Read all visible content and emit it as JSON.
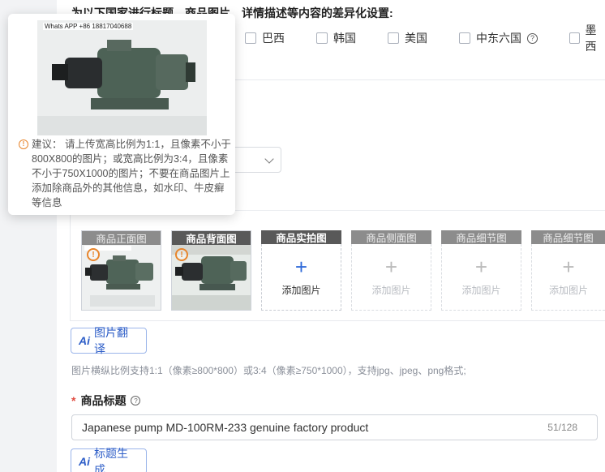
{
  "countries": {
    "heading": "为以下国家进行标题、商品图片、详情描述等内容的差异化设置:",
    "items": [
      {
        "label": "巴西"
      },
      {
        "label": "韩国"
      },
      {
        "label": "美国"
      },
      {
        "label": "中东六国",
        "help": "?"
      },
      {
        "label": "墨西"
      }
    ]
  },
  "images": {
    "slots": [
      {
        "title": "商品正面图",
        "style": "grey",
        "filled": true,
        "watermark": "Whats APP +86 18817040688"
      },
      {
        "title": "商品背面图",
        "style": "dark",
        "filled": true,
        "watermark": "Magnet Pump"
      },
      {
        "title": "商品实拍图",
        "style": "dark",
        "add_label": "添加图片"
      },
      {
        "title": "商品侧面图",
        "style": "grey",
        "add_label": "添加图片"
      },
      {
        "title": "商品细节图",
        "style": "grey",
        "add_label": "添加图片"
      },
      {
        "title": "商品细节图",
        "style": "grey",
        "add_label": "添加图片"
      }
    ],
    "translate_button": {
      "ai": "Ai",
      "label": "图片翻译"
    },
    "hint": "图片横纵比例支持1:1（像素≥800*800）或3:4（像素≥750*1000），支持jpg、jpeg、png格式;"
  },
  "title_field": {
    "required": "*",
    "label": "商品标题",
    "help": "?",
    "value": "Japanese  pump MD-100RM-233 genuine factory product",
    "counter": "51/128",
    "generate_button": {
      "ai": "Ai",
      "label": "标题生成"
    }
  },
  "tooltip": {
    "watermark": "Whats APP +86 18817040688",
    "warn_icon": "!",
    "text": "建议： 请上传宽高比例为1:1，且像素不小于800X800的图片；或宽高比例为3:4，且像素不小于750X1000的图片；不要在商品图片上添加除商品外的其他信息，如水印、牛皮癣等信息"
  },
  "colors": {
    "accent": "#2f5fc8",
    "warning": "#e8852b",
    "header_dark": "#595959",
    "header_grey": "#8c8c8c",
    "required": "#e04a3f"
  }
}
